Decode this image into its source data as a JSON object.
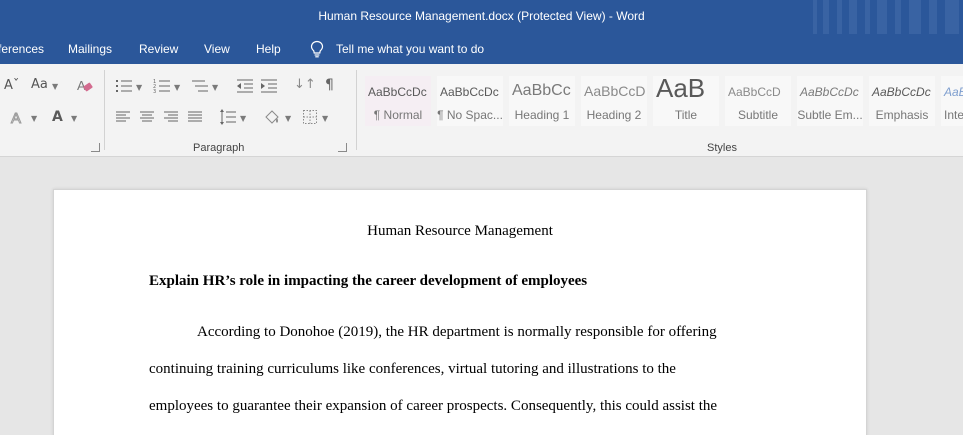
{
  "window": {
    "title": "Human Resource Management.docx (Protected View)  -  Word"
  },
  "tabs": [
    {
      "label": "ferences"
    },
    {
      "label": "Mailings"
    },
    {
      "label": "Review"
    },
    {
      "label": "View"
    },
    {
      "label": "Help"
    }
  ],
  "tell_me": {
    "label": "Tell me what you want to do",
    "icon": "lightbulb-icon"
  },
  "ribbon": {
    "font_group": {
      "change_case_label": "Aa",
      "font_color_label": "A"
    },
    "paragraph_group": {
      "label": "Paragraph"
    },
    "styles_group": {
      "label": "Styles",
      "styles": [
        {
          "sample": "AaBbCcDc",
          "name": "¶ Normal"
        },
        {
          "sample": "AaBbCcDc",
          "name": "¶ No Spac..."
        },
        {
          "sample": "AaBbCc",
          "name": "Heading 1"
        },
        {
          "sample": "AaBbCcD",
          "name": "Heading 2"
        },
        {
          "sample": "AaB",
          "name": "Title"
        },
        {
          "sample": "AaBbCcD",
          "name": "Subtitle"
        },
        {
          "sample": "AaBbCcDc",
          "name": "Subtle Em..."
        },
        {
          "sample": "AaBbCcDc",
          "name": "Emphasis"
        },
        {
          "sample": "AaBb",
          "name": "Inte"
        }
      ]
    }
  },
  "document": {
    "title": "Human Resource Management",
    "heading": "Explain HR’s role in impacting the career development of employees",
    "lines": [
      "According to Donohoe (2019), the HR department is normally responsible for offering",
      "continuing training curriculums like conferences, virtual tutoring and illustrations to the",
      "employees to guarantee their expansion of career prospects. Consequently, this could assist the"
    ]
  },
  "colors": {
    "brand_blue": "#2b579a",
    "ribbon_bg": "#f3f3f3",
    "doc_bg": "#e6e6e6"
  }
}
